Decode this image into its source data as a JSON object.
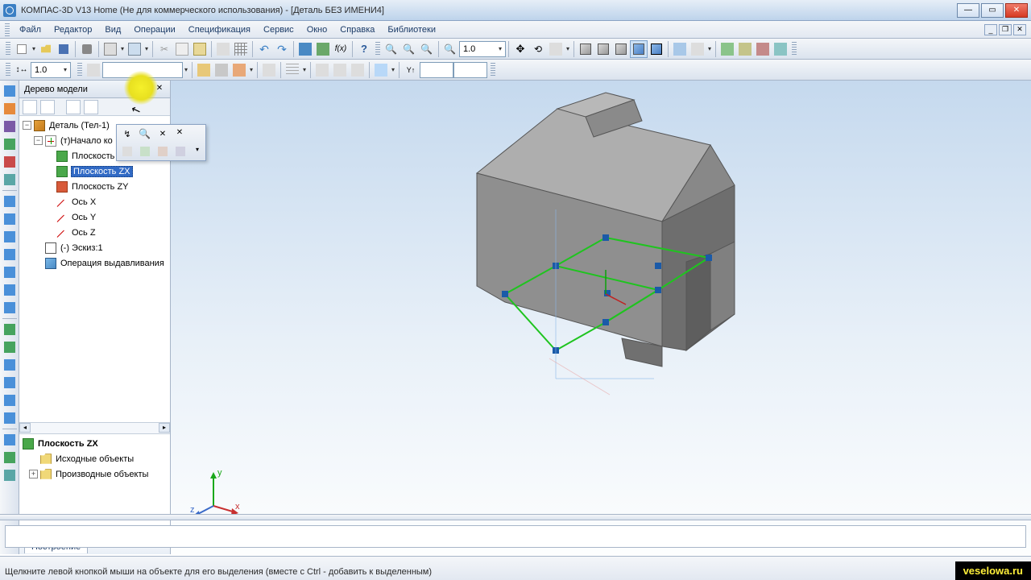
{
  "title": "КОМПАС-3D V13 Home (Не для коммерческого использования) - [Деталь БЕЗ ИМЕНИ4]",
  "menus": [
    "Файл",
    "Редактор",
    "Вид",
    "Операции",
    "Спецификация",
    "Сервис",
    "Окно",
    "Справка",
    "Библиотеки"
  ],
  "zoom_value": "1.0",
  "step_value": "1.0",
  "tree": {
    "title": "Дерево модели",
    "root": "Деталь (Тел-1)",
    "origin": "(т)Начало ко",
    "plane_xy": "Плоскость XY",
    "plane_zx": "Плоскость ZX",
    "plane_zy": "Плоскость ZY",
    "axis_x": "Ось X",
    "axis_y": "Ось Y",
    "axis_z": "Ось Z",
    "sketch": "(-) Эскиз:1",
    "extrude": "Операция выдавливания",
    "selected": "Плоскость ZX",
    "src_folder": "Исходные объекты",
    "deriv_folder": "Производные объекты",
    "tab": "Построение"
  },
  "orient": {
    "x": "x",
    "y": "y",
    "z": "z"
  },
  "status": "Щелкните левой кнопкой мыши на объекте для его выделения (вместе с Ctrl - добавить к выделенным)",
  "watermark": "veselowa.ru"
}
